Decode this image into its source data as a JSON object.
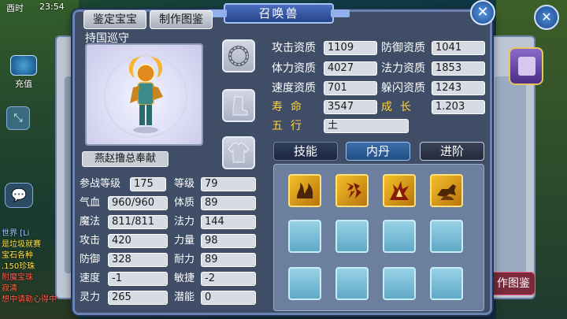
{
  "hud": {
    "time_label": "酉时",
    "clock": "23:54",
    "recharge_label": "充值"
  },
  "chat": {
    "lines": [
      "世界 [Li",
      "是垃圾就赛",
      "宝石各种",
      ".150珍珠",
      "附魔宝珠",
      "寂清",
      "想中请勒心得中"
    ]
  },
  "panel": {
    "title": "召唤兽",
    "identify_button": "鉴定宝宝",
    "atlas_button": "制作图鉴",
    "pet_name": "持国巡守",
    "owner": "燕赵撸总奉献",
    "close_icon": "close-icon"
  },
  "left_stats": [
    {
      "label": "参战等级",
      "value": "175"
    },
    {
      "label": "等级",
      "value": "79"
    },
    {
      "label": "气血",
      "value": "960/960"
    },
    {
      "label": "体质",
      "value": "89"
    },
    {
      "label": "魔法",
      "value": "811/811"
    },
    {
      "label": "法力",
      "value": "144"
    },
    {
      "label": "攻击",
      "value": "420"
    },
    {
      "label": "力量",
      "value": "98"
    },
    {
      "label": "防御",
      "value": "328"
    },
    {
      "label": "耐力",
      "value": "89"
    },
    {
      "label": "速度",
      "value": "-1"
    },
    {
      "label": "敏捷",
      "value": "-2"
    },
    {
      "label": "灵力",
      "value": "265"
    },
    {
      "label": "潜能",
      "value": "0"
    }
  ],
  "aptitudes": [
    {
      "label": "攻击资质",
      "value": "1109"
    },
    {
      "label": "防御资质",
      "value": "1041"
    },
    {
      "label": "体力资质",
      "value": "4027"
    },
    {
      "label": "法力资质",
      "value": "1853"
    },
    {
      "label": "速度资质",
      "value": "701"
    },
    {
      "label": "躲闪资质",
      "value": "1243"
    },
    {
      "label": "寿命",
      "value": "3547"
    },
    {
      "label": "成长",
      "value": "1.203"
    },
    {
      "label": "五行",
      "value": "土"
    }
  ],
  "tabs": [
    "技能",
    "内丹",
    "进阶"
  ],
  "skills": [
    "flame-icon",
    "fist-icon",
    "burst-icon",
    "tiger-icon"
  ],
  "background_button": "作图鉴",
  "colors": {
    "accent_gold": "#ffd23c",
    "panel_bg": "#3f4d67",
    "tab_active": "#3c6fa8"
  }
}
